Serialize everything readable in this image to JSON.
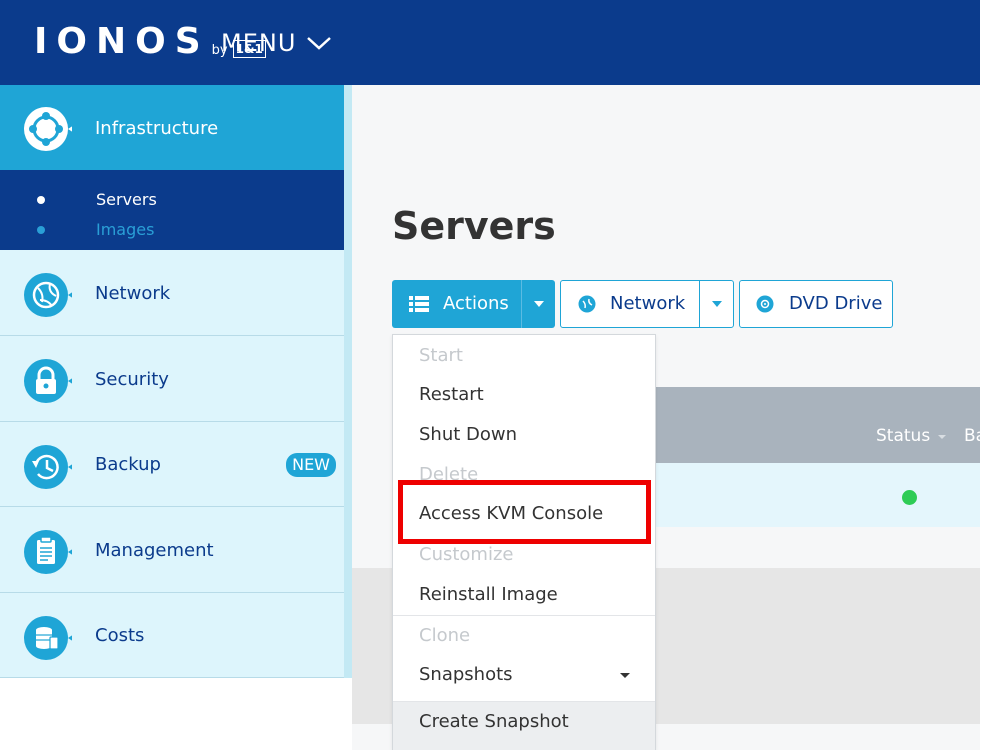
{
  "header": {
    "logo_text": "IONOS",
    "logo_by": "by",
    "logo_badge": "1&1",
    "menu_label": "MENU"
  },
  "sidebar": {
    "items": [
      {
        "label": "Infrastructure",
        "icon": "infrastructure-icon",
        "active": true
      },
      {
        "label": "Network",
        "icon": "globe-icon"
      },
      {
        "label": "Security",
        "icon": "lock-icon"
      },
      {
        "label": "Backup",
        "icon": "backup-clock-icon",
        "badge": "NEW"
      },
      {
        "label": "Management",
        "icon": "clipboard-icon"
      },
      {
        "label": "Costs",
        "icon": "coins-icon"
      }
    ],
    "submenu": [
      {
        "label": "Servers",
        "active": true
      },
      {
        "label": "Images",
        "active": false
      }
    ]
  },
  "main": {
    "title": "Servers",
    "toolbar": {
      "actions_label": "Actions",
      "network_label": "Network",
      "dvd_label": "DVD Drive"
    },
    "table": {
      "columns": [
        "Status",
        "Ba"
      ],
      "rows": [
        {
          "status": "running"
        }
      ]
    }
  },
  "dropdown": {
    "items": [
      {
        "label": "Start",
        "enabled": false
      },
      {
        "label": "Restart",
        "enabled": true
      },
      {
        "label": "Shut Down",
        "enabled": true
      },
      {
        "label": "Delete",
        "enabled": false
      },
      {
        "label": "Access KVM Console",
        "enabled": true,
        "highlighted": true
      },
      {
        "label": "Customize",
        "enabled": false
      },
      {
        "label": "Reinstall Image",
        "enabled": true
      },
      {
        "label": "Clone",
        "enabled": false
      },
      {
        "label": "Snapshots",
        "enabled": true,
        "submenu": true
      },
      {
        "label": "Create Snapshot",
        "enabled": true
      }
    ]
  },
  "colors": {
    "header_bg": "#0b3b8c",
    "accent": "#1fa5d6",
    "sidebar_bg": "#ddf5fc",
    "highlight": "#ee0000",
    "status_running": "#2ecc55"
  }
}
